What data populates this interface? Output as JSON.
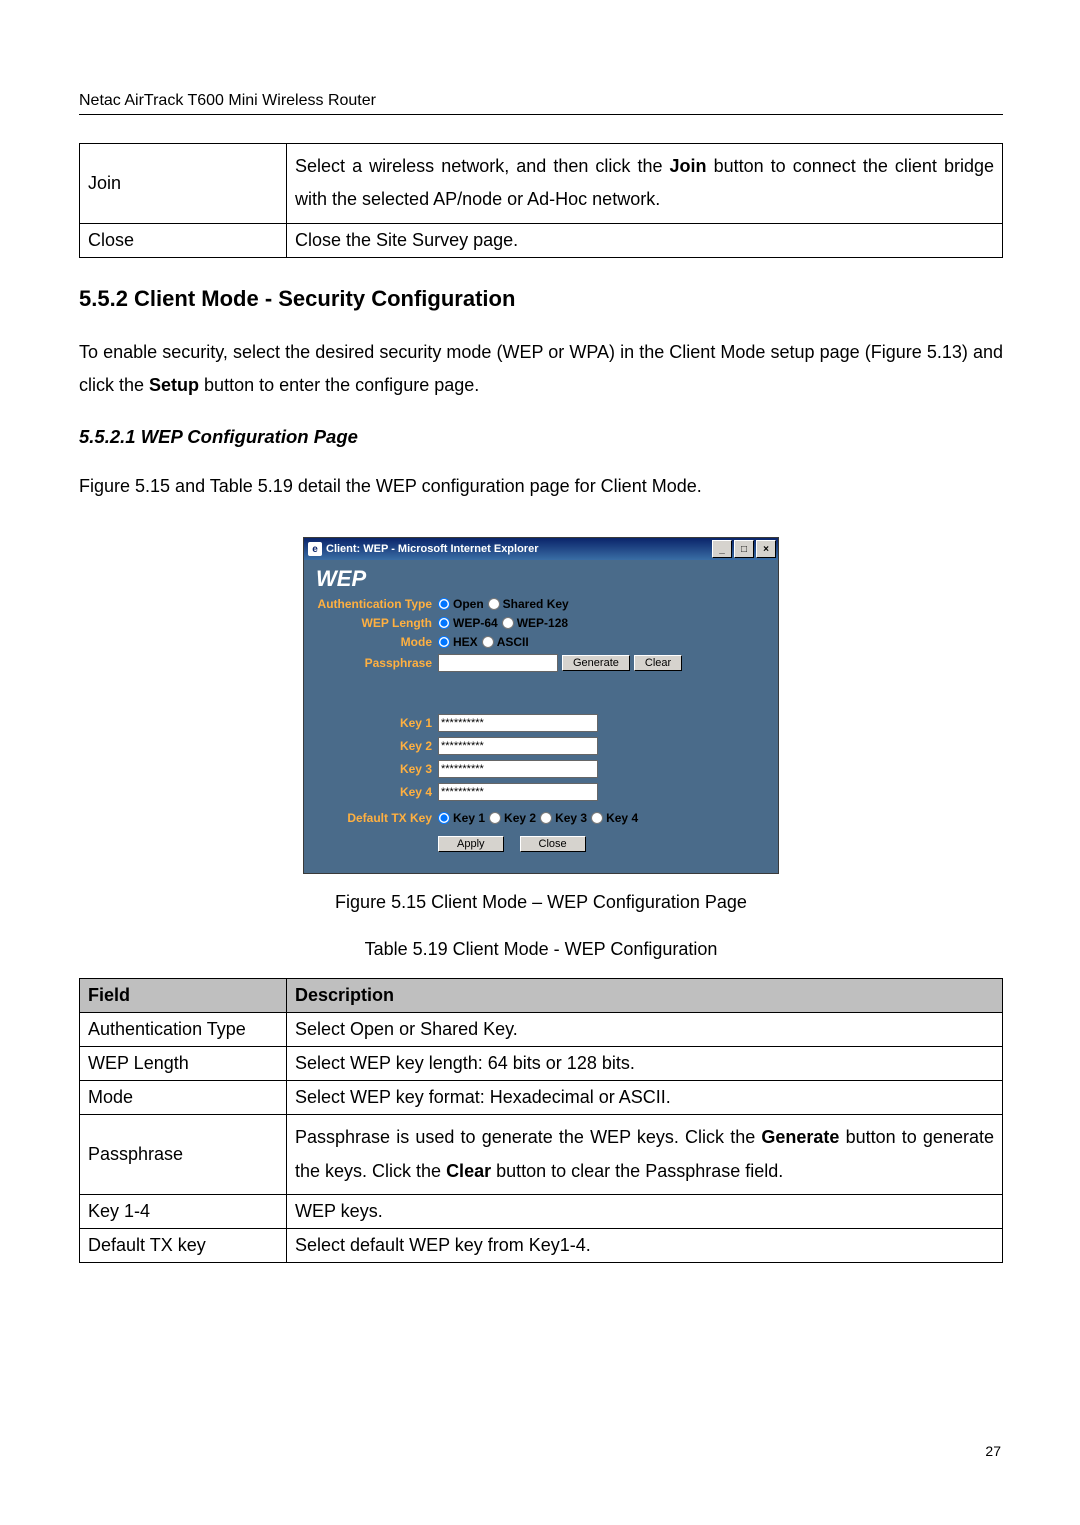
{
  "header": "Netac AirTrack T600 Mini Wireless Router",
  "page_number": "27",
  "top_table": {
    "rows": [
      {
        "field": "Join",
        "desc_parts": [
          "Select a wireless network, and then click the ",
          "Join",
          " button to connect the client bridge with the selected AP/node or Ad-Hoc network."
        ]
      },
      {
        "field": "Close",
        "desc": "Close the Site Survey page."
      }
    ]
  },
  "section_heading": "5.5.2 Client Mode - Security Configuration",
  "section_para_parts": [
    "To enable security, select the desired security mode (WEP or WPA) in the Client Mode setup page (Figure 5.13) and click the ",
    "Setup",
    " button to enter the configure page."
  ],
  "sub_heading": "5.5.2.1 WEP Configuration Page",
  "sub_para": "Figure 5.15 and Table 5.19 detail the WEP configuration page for Client Mode.",
  "figure": {
    "window_title": "Client: WEP - Microsoft Internet Explorer",
    "panel_title": "WEP",
    "rows": {
      "auth_label": "Authentication Type",
      "auth_opts": [
        "Open",
        "Shared Key"
      ],
      "wep_len_label": "WEP Length",
      "wep_len_opts": [
        "WEP-64",
        "WEP-128"
      ],
      "mode_label": "Mode",
      "mode_opts": [
        "HEX",
        "ASCII"
      ],
      "pass_label": "Passphrase",
      "pass_btns": [
        "Generate",
        "Clear"
      ],
      "key_labels": [
        "Key 1",
        "Key 2",
        "Key 3",
        "Key 4"
      ],
      "key_value": "**********",
      "txkey_label": "Default TX Key",
      "txkey_opts": [
        "Key 1",
        "Key 2",
        "Key 3",
        "Key 4"
      ],
      "bottom_btns": [
        "Apply",
        "Close"
      ]
    },
    "caption": "Figure 5.15 Client Mode – WEP Configuration Page"
  },
  "table2": {
    "caption": "Table 5.19 Client Mode - WEP Configuration",
    "header": [
      "Field",
      "Description"
    ],
    "rows": [
      {
        "field": "Authentication Type",
        "desc": "Select Open or Shared Key."
      },
      {
        "field": "WEP Length",
        "desc": "Select WEP key length: 64 bits or 128 bits."
      },
      {
        "field": "Mode",
        "desc": "Select WEP key format: Hexadecimal or ASCII."
      },
      {
        "field": "Passphrase",
        "desc_parts": [
          "Passphrase is used to generate the WEP keys. Click the ",
          "Generate",
          " button to generate the keys. Click the ",
          "Clear",
          " button to clear the Passphrase field."
        ]
      },
      {
        "field": "Key 1-4",
        "desc": "WEP keys."
      },
      {
        "field": "Default TX key",
        "desc": "Select default WEP key from Key1-4."
      }
    ]
  }
}
